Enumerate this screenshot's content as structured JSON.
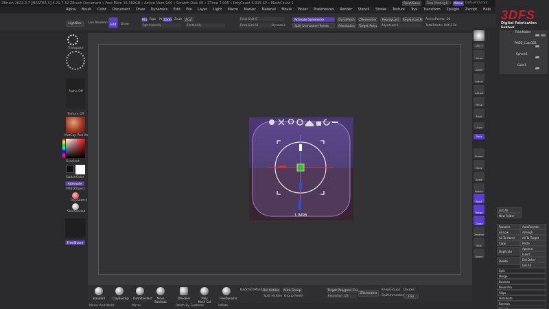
{
  "titlebar": {
    "text": "ZBrush 2022.0.7 [MASTER X] 4.21.7.32    ZBrush Document          • Free Mem 16.362GB • Active Mem 944 • Scratch Disk 49 • ZTime 7.005 • PolyCount 6.915 KP • MeshCount 1",
    "quicksave": "QuickSave",
    "seethrough": "See-through  0",
    "menus": "Menus",
    "script": "DefaultZScript"
  },
  "menubar": {
    "items": [
      "Alpha",
      "Brush",
      "Color",
      "Document",
      "Draw",
      "Dynamics",
      "Edit",
      "File",
      "Layer",
      "Light",
      "Macro",
      "Marker",
      "Material",
      "Movie",
      "Picker",
      "Preferences",
      "Render",
      "Stencil",
      "Stroke",
      "Texture",
      "Tool",
      "Transform",
      "Zplugin",
      "Zscript",
      "Help"
    ]
  },
  "shelf": {
    "lightbox": "LightBox",
    "live_boolean": "Live Boolean",
    "edit": "Edit",
    "draw": "Draw",
    "mrgb": "Mrgb",
    "rgb": "Rgb",
    "m": "M",
    "zadd": "Zadd",
    "zsub": "Zsub",
    "zcut": "Zcut",
    "rgb_intensity": "Rgb Intensity",
    "z_intensity": "Z Intensity",
    "focal_shift": "Focal Shift 0",
    "draw_size": "Draw Size 64",
    "dynamic": "Dynamic",
    "activate_symmetry": "Activate Symmetry",
    "split_unmasked": "Split Unmasked Points",
    "dynamesh": "DynaMesh",
    "resolution": "Resolution",
    "zremesher": "ZRemesher",
    "target_polys": "Target Polygons",
    "replay_last": "ReplayLast",
    "replay_last_rel": "ReplayLastRel",
    "adjust_last": "AdjustLast 1",
    "active_points": "ActivePoints: 16",
    "total_points": "TotalPoints: 846,134"
  },
  "left": {
    "transpose": "Transpose",
    "alpha_off": "Alpha Off",
    "texture_off": "Texture Off",
    "matcap": "MatCap Red Wax",
    "gradient": "Gradient",
    "switch_color": "SwitchColor",
    "alternate": "Alternate",
    "pm3d_object": "PM3DObject",
    "polysketch": "PolySketch",
    "skinshade": "SkinShade4",
    "freeshave": "FreeShave"
  },
  "viewport": {
    "gizmo_value": "1.0496",
    "gizmo_icons": [
      "gear-icon",
      "stretch-icon",
      "pin-icon",
      "sync-icon",
      "home-icon",
      "unlock-icon",
      "undo-icon",
      "minus-icon"
    ]
  },
  "rightbar": {
    "items": [
      "BPR",
      "SPix 3",
      "Scroll",
      "Zoom",
      "Actual",
      "AAHalf",
      "Persp",
      "Floor",
      "LSym",
      "Gxyz",
      "Frame",
      "Move",
      "Scale",
      "Rotate",
      "PolyF",
      "Transp",
      "Ghost",
      "Dynamic",
      "Solo",
      "Xpose"
    ]
  },
  "rightpanel": {
    "title": "Subtool",
    "subtools": [
      "ThickMatter",
      "PM3D_Cube3D1",
      "Sphere1",
      "Cube1"
    ],
    "list_all": "List All",
    "new_folder": "New Folder",
    "rename": "Rename",
    "autoreorder": "AutoReorder",
    "all_low": "All Low",
    "all_high": "All High",
    "all_to_home": "All To Home",
    "all_to_target": "All To Target",
    "copy": "Copy",
    "paste": "Paste",
    "duplicate": "Duplicate",
    "append": "Append",
    "insert": "Insert",
    "delete": "Delete",
    "del_other": "Del Other",
    "del_all": "Del All",
    "split": "Split",
    "merge": "Merge",
    "boolean": "Boolean",
    "bevel_pro": "Bevel Pro",
    "align": "Align",
    "distribute": "Distribute",
    "remesh": "Remesh",
    "project": "Project"
  },
  "bottom": {
    "brushes": [
      "Standard",
      "ClayBuildup",
      "DamStandard",
      "Move Topologic",
      "ZModeler",
      "Polly Mesh Cut",
      "FreeDynamic"
    ],
    "backface_mask": "BackfaceMask",
    "del_hidden": "Del Hidden",
    "auto_groups": "Auto Groups",
    "split_hidden": "Split Hidden",
    "group_polish": "Group Polish",
    "target_polygons_count": "Target Polygons Count",
    "zremesher": "ZRemesher",
    "resolution_label": "Resolution 128",
    "lazy_mouse": "LazyMouse",
    "lazy_step": "LazyStep",
    "keep_groups": "KeepGroups",
    "double": "Double",
    "flip": "Flip",
    "mirror_and_weld": "Mirror And Weld",
    "mirror": "Mirror",
    "polish_by_features": "Polish By Features",
    "inflate": "Inflate",
    "polish": "Polish",
    "split_unmasked": "SplitUnmasked"
  },
  "colors": {
    "accent": "#5b3fd0",
    "orange": "#e0892a",
    "logo_red": "#c3202f"
  },
  "logo": {
    "text": "3DFS",
    "subtitle": "Digital Fabrication"
  }
}
